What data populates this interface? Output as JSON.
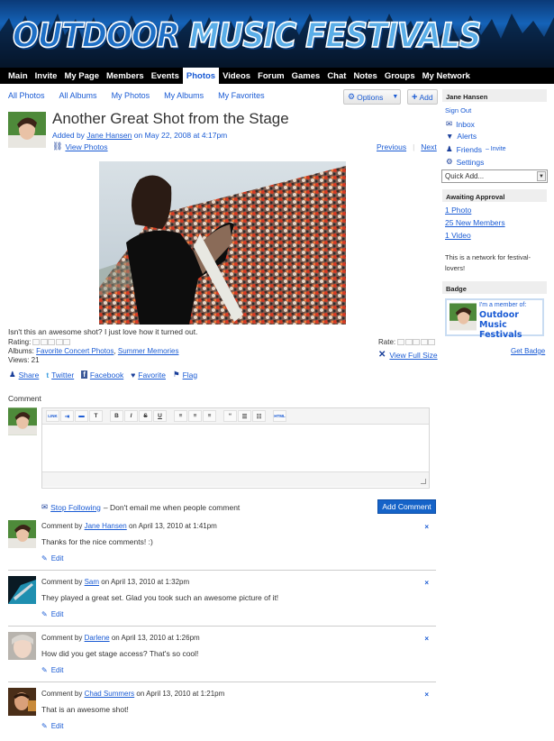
{
  "site": {
    "title_word1": "OUTDOOR",
    "title_rest": "MUSIC FESTIVALS"
  },
  "nav": {
    "items": [
      "Main",
      "Invite",
      "My Page",
      "Members",
      "Events",
      "Photos",
      "Videos",
      "Forum",
      "Games",
      "Chat",
      "Notes",
      "Groups",
      "My Network"
    ],
    "active": "Photos"
  },
  "subnav": {
    "items": [
      "All Photos",
      "All Albums",
      "My Photos",
      "My Albums",
      "My Favorites"
    ]
  },
  "toolbar": {
    "options_label": "Options",
    "add_label": "Add"
  },
  "photo": {
    "title": "Another Great Shot from the Stage",
    "added_prefix": "Added by",
    "author": "Jane Hansen",
    "added_suffix": "on May 22, 2008 at 4:17pm",
    "view_photos": "View Photos",
    "previous": "Previous",
    "next": "Next",
    "caption": "Isn't this an awesome shot? I just love how it turned out.",
    "rating_label": "Rating:",
    "rating_value": 0,
    "rating_max": 5,
    "albums_label": "Albums:",
    "album1": "Favorite Concert Photos",
    "album_sep": ",",
    "album2": "Summer Memories",
    "views": "Views: 21",
    "rate_label": "Rate:",
    "view_full_size": "View Full Size"
  },
  "actions": {
    "share": "Share",
    "twitter": "Twitter",
    "facebook": "Facebook",
    "favorite": "Favorite",
    "flag": "Flag"
  },
  "comment_form": {
    "label": "Comment",
    "toolbar": [
      "LINK",
      "link",
      "img",
      "T",
      "B",
      "I",
      "S",
      "U",
      "left",
      "center",
      "right",
      "quote",
      "ul",
      "ol",
      "HTML"
    ],
    "stop_following": "Stop Following",
    "follow_note": "– Don't email me when people comment",
    "submit": "Add Comment"
  },
  "comments": [
    {
      "by_prefix": "Comment by",
      "author": "Jane Hansen",
      "date": "on April 13, 2010 at 1:41pm",
      "text": "Thanks for the nice comments! :)",
      "edit": "Edit",
      "delete": "×"
    },
    {
      "by_prefix": "Comment by",
      "author": "Sam",
      "date": "on April 13, 2010 at 1:32pm",
      "text": "They played a great set. Glad you took such an awesome picture of it!",
      "edit": "Edit",
      "delete": "×"
    },
    {
      "by_prefix": "Comment by",
      "author": "Darlene",
      "date": "on April 13, 2010 at 1:26pm",
      "text": "How did you get stage access? That's so cool!",
      "edit": "Edit",
      "delete": "×"
    },
    {
      "by_prefix": "Comment by",
      "author": "Chad Summers",
      "date": "on April 13, 2010 at 1:21pm",
      "text": "That is an awesome shot!",
      "edit": "Edit",
      "delete": "×"
    }
  ],
  "sidebar": {
    "user_name": "Jane Hansen",
    "sign_out": "Sign Out",
    "inbox": "Inbox",
    "alerts": "Alerts",
    "friends": "Friends",
    "invite": "– Invite",
    "settings": "Settings",
    "quick_add": "Quick Add...",
    "approval_head": "Awaiting Approval",
    "approval_items": [
      "1 Photo",
      "25 New Members",
      "1 Video"
    ],
    "about": "This is a network for festival-lovers!",
    "badge_head": "Badge",
    "badge_line1": "I'm a member of:",
    "badge_line2": "Outdoor Music Festivals",
    "get_badge": "Get Badge"
  },
  "colors": {
    "link": "#1a5bd4",
    "nav_bg": "#000000",
    "button_primary": "#1563c8",
    "header_blue": "#1d6fc6"
  }
}
